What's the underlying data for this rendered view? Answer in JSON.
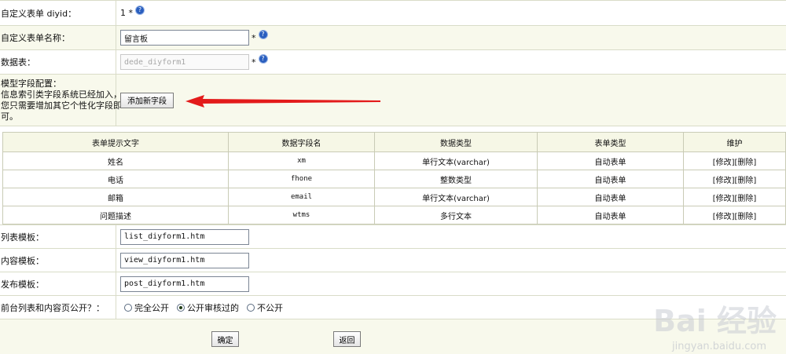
{
  "form": {
    "diyid": {
      "label": "自定义表单 diyid：",
      "value": "1 *"
    },
    "name": {
      "label": "自定义表单名称：",
      "value": "留言板",
      "required": "*"
    },
    "table": {
      "label": "数据表：",
      "value": "dede_diyform1",
      "required": "*"
    },
    "fields_config": {
      "label_line1": "模型字段配置：",
      "label_line2": "信息索引类字段系统已经加入，",
      "label_line3": "您只需要增加其它个性化字段即",
      "label_line4": "可。",
      "add_button": "添加新字段"
    },
    "annotation_arrow_color": "#e31b1b",
    "fields_table": {
      "headers": [
        "表单提示文字",
        "数据字段名",
        "数据类型",
        "表单类型",
        "维护"
      ],
      "rows": [
        {
          "prompt": "姓名",
          "field": "xm",
          "type": "单行文本(varchar)",
          "form_type": "自动表单",
          "edit": "[修改]",
          "delete": "[删除]"
        },
        {
          "prompt": "电话",
          "field": "fhone",
          "type": "整数类型",
          "form_type": "自动表单",
          "edit": "[修改]",
          "delete": "[删除]"
        },
        {
          "prompt": "邮箱",
          "field": "email",
          "type": "单行文本(varchar)",
          "form_type": "自动表单",
          "edit": "[修改]",
          "delete": "[删除]"
        },
        {
          "prompt": "问题描述",
          "field": "wtms",
          "type": "多行文本",
          "form_type": "自动表单",
          "edit": "[修改]",
          "delete": "[删除]"
        }
      ]
    },
    "list_template": {
      "label": "列表模板：",
      "value": "list_diyform1.htm"
    },
    "view_template": {
      "label": "内容模板：",
      "value": "view_diyform1.htm"
    },
    "post_template": {
      "label": "发布模板：",
      "value": "post_diyform1.htm"
    },
    "public": {
      "label": "前台列表和内容页公开？：",
      "options": [
        "完全公开",
        "公开审核过的",
        "不公开"
      ],
      "selected": "公开审核过的"
    },
    "confirm_button": "确定",
    "back_button": "返回"
  },
  "watermark": {
    "brand": "Bai 经验",
    "url": "jingyan.baidu.com"
  }
}
